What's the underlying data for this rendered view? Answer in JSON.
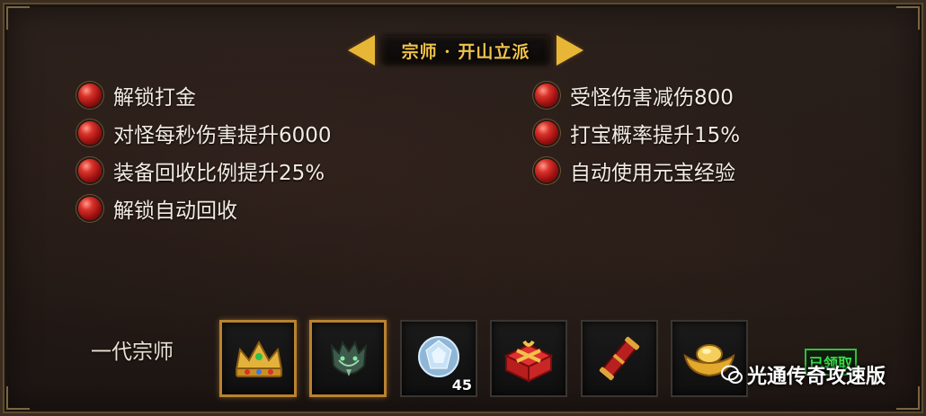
{
  "title": "宗师 · 开山立派",
  "effects_left": [
    "解锁打金",
    "对怪每秒伤害提升6000",
    "装备回收比例提升25%",
    "解锁自动回收"
  ],
  "effects_right": [
    "受怪伤害减伤800",
    "打宝概率提升15%",
    "自动使用元宝经验"
  ],
  "rank_label": "一代宗师",
  "slots": [
    {
      "icon": "golden-crown-icon",
      "count": "",
      "highlighted": true
    },
    {
      "icon": "jade-dragon-helmet-icon",
      "count": "",
      "highlighted": true
    },
    {
      "icon": "diamond-gem-icon",
      "count": "45",
      "highlighted": false
    },
    {
      "icon": "red-gift-box-icon",
      "count": "",
      "highlighted": false
    },
    {
      "icon": "red-scroll-icon",
      "count": "",
      "highlighted": false
    },
    {
      "icon": "gold-ingot-icon",
      "count": "",
      "highlighted": false
    }
  ],
  "claimed_label": "已领取",
  "watermark": "光通传奇攻速版",
  "colors": {
    "title_gold": "#f0c34a",
    "bullet_red": "#d8322a",
    "highlight_border": "#b9822f",
    "claimed_green": "#39e04a"
  }
}
